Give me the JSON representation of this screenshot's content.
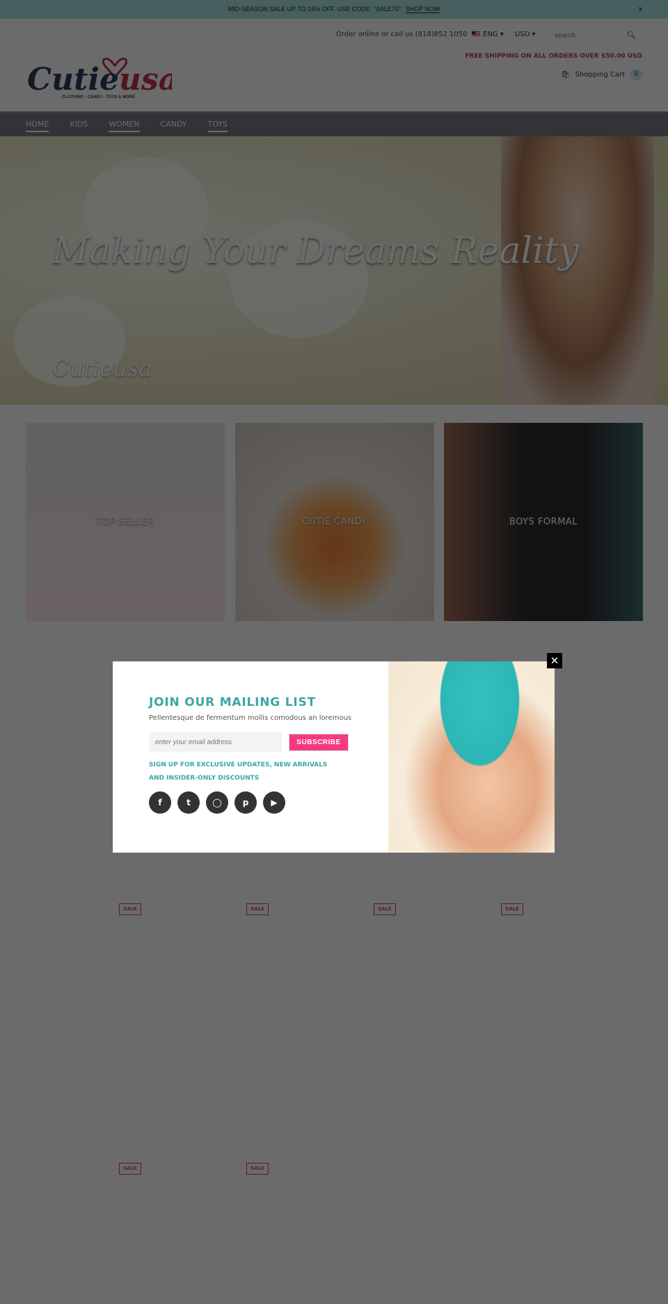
{
  "topbar": {
    "text": "MID-SEASON SALE UP TO 15% OFF. USE CODE: \"SALE70\".",
    "link": "SHOP NOW",
    "close": "×"
  },
  "header": {
    "order": "Order online or call us (818)852 1050",
    "lang": "ENG ▾",
    "currency": "USD ▾",
    "search_placeholder": "search",
    "free_shipping": "FREE SHIPPING ON ALL ORDERS OVER $50.00 USD",
    "cart_label": "Shopping Cart",
    "cart_count": "0",
    "logo_text": "Cutieusa",
    "logo_tagline": "CLOTHING - CANDY - TOYS & MORE"
  },
  "nav": [
    {
      "label": "HOME"
    },
    {
      "label": "KIDS"
    },
    {
      "label": "WOMEN"
    },
    {
      "label": "CANDY"
    },
    {
      "label": "TOYS"
    }
  ],
  "hero": {
    "headline": "Making Your Dreams Reality",
    "logo": "Cutieusa"
  },
  "tiles": [
    {
      "label": "TOP SELLER"
    },
    {
      "label": "CUTIE CANDY"
    },
    {
      "label": "BOYS FORMAL"
    }
  ],
  "sale_badge": "SALE",
  "modal": {
    "title": "JOIN OUR MAILING LIST",
    "subtitle": "Pellentesque de fermentum mollis comodous an loremous",
    "email_placeholder": "enter your email address",
    "subscribe": "SUBSCRIBE",
    "promo_line1": "SIGN UP FOR EXCLUSIVE UPDATES, NEW ARRIVALS",
    "promo_line2": "AND INSIDER-ONLY DISCOUNTS",
    "close": "✕",
    "social": [
      "facebook",
      "twitter",
      "instagram",
      "pinterest",
      "youtube"
    ]
  },
  "colors": {
    "accent": "#3aa7a3",
    "subscribe": "#f53b7d",
    "brand_pink": "#c0334c"
  }
}
